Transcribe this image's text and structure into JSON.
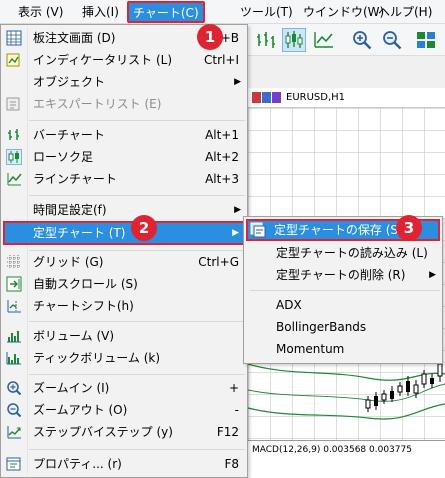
{
  "menubar": {
    "view": "表示 (V)",
    "insert": "挿入(I)",
    "chart": "チャート(C)",
    "tools": "ツール(T)",
    "window": "ウインドウ(W)",
    "help": "ヘルプ(H)"
  },
  "chart_window": {
    "title": "EURUSD,H1",
    "macd_label": "MACD(12,26,9) 0.003568 0.003775"
  },
  "main_menu": {
    "items": [
      {
        "label": "板注文画面 (D)",
        "shortcut": "Alt+B"
      },
      {
        "label": "インディケータリスト (L)",
        "shortcut": "Ctrl+I"
      },
      {
        "label": "オブジェクト",
        "submenu": "▶"
      },
      {
        "label": "エキスパートリスト (E)"
      },
      {
        "label": "バーチャート",
        "shortcut": "Alt+1"
      },
      {
        "label": "ローソク足",
        "shortcut": "Alt+2"
      },
      {
        "label": "ラインチャート",
        "shortcut": "Alt+3"
      },
      {
        "label": "時間足設定(f)",
        "submenu": "▶"
      },
      {
        "label": "定型チャート (T)",
        "submenu": "▶"
      },
      {
        "label": "グリッド (G)",
        "shortcut": "Ctrl+G"
      },
      {
        "label": "自動スクロール (S)"
      },
      {
        "label": "チャートシフト(h)"
      },
      {
        "label": "ボリューム (V)"
      },
      {
        "label": "ティックボリューム (k)"
      },
      {
        "label": "ズームイン (I)",
        "shortcut": "+"
      },
      {
        "label": "ズームアウト (O)",
        "shortcut": "-"
      },
      {
        "label": "ステップバイステップ (y)",
        "shortcut": "F12"
      },
      {
        "label": "プロパティ... (r)",
        "shortcut": "F8"
      }
    ]
  },
  "sub_menu": {
    "items": [
      {
        "label": "定型チャートの保存 (S)"
      },
      {
        "label": "定型チャートの読み込み (L)"
      },
      {
        "label": "定型チャートの削除 (R)",
        "submenu": "▶"
      },
      {
        "label": "ADX"
      },
      {
        "label": "BollingerBands"
      },
      {
        "label": "Momentum"
      }
    ]
  },
  "callouts": {
    "one": "1",
    "two": "2",
    "three": "3"
  },
  "colors": {
    "highlight": "#2a8fe0",
    "callout": "#e02330"
  }
}
